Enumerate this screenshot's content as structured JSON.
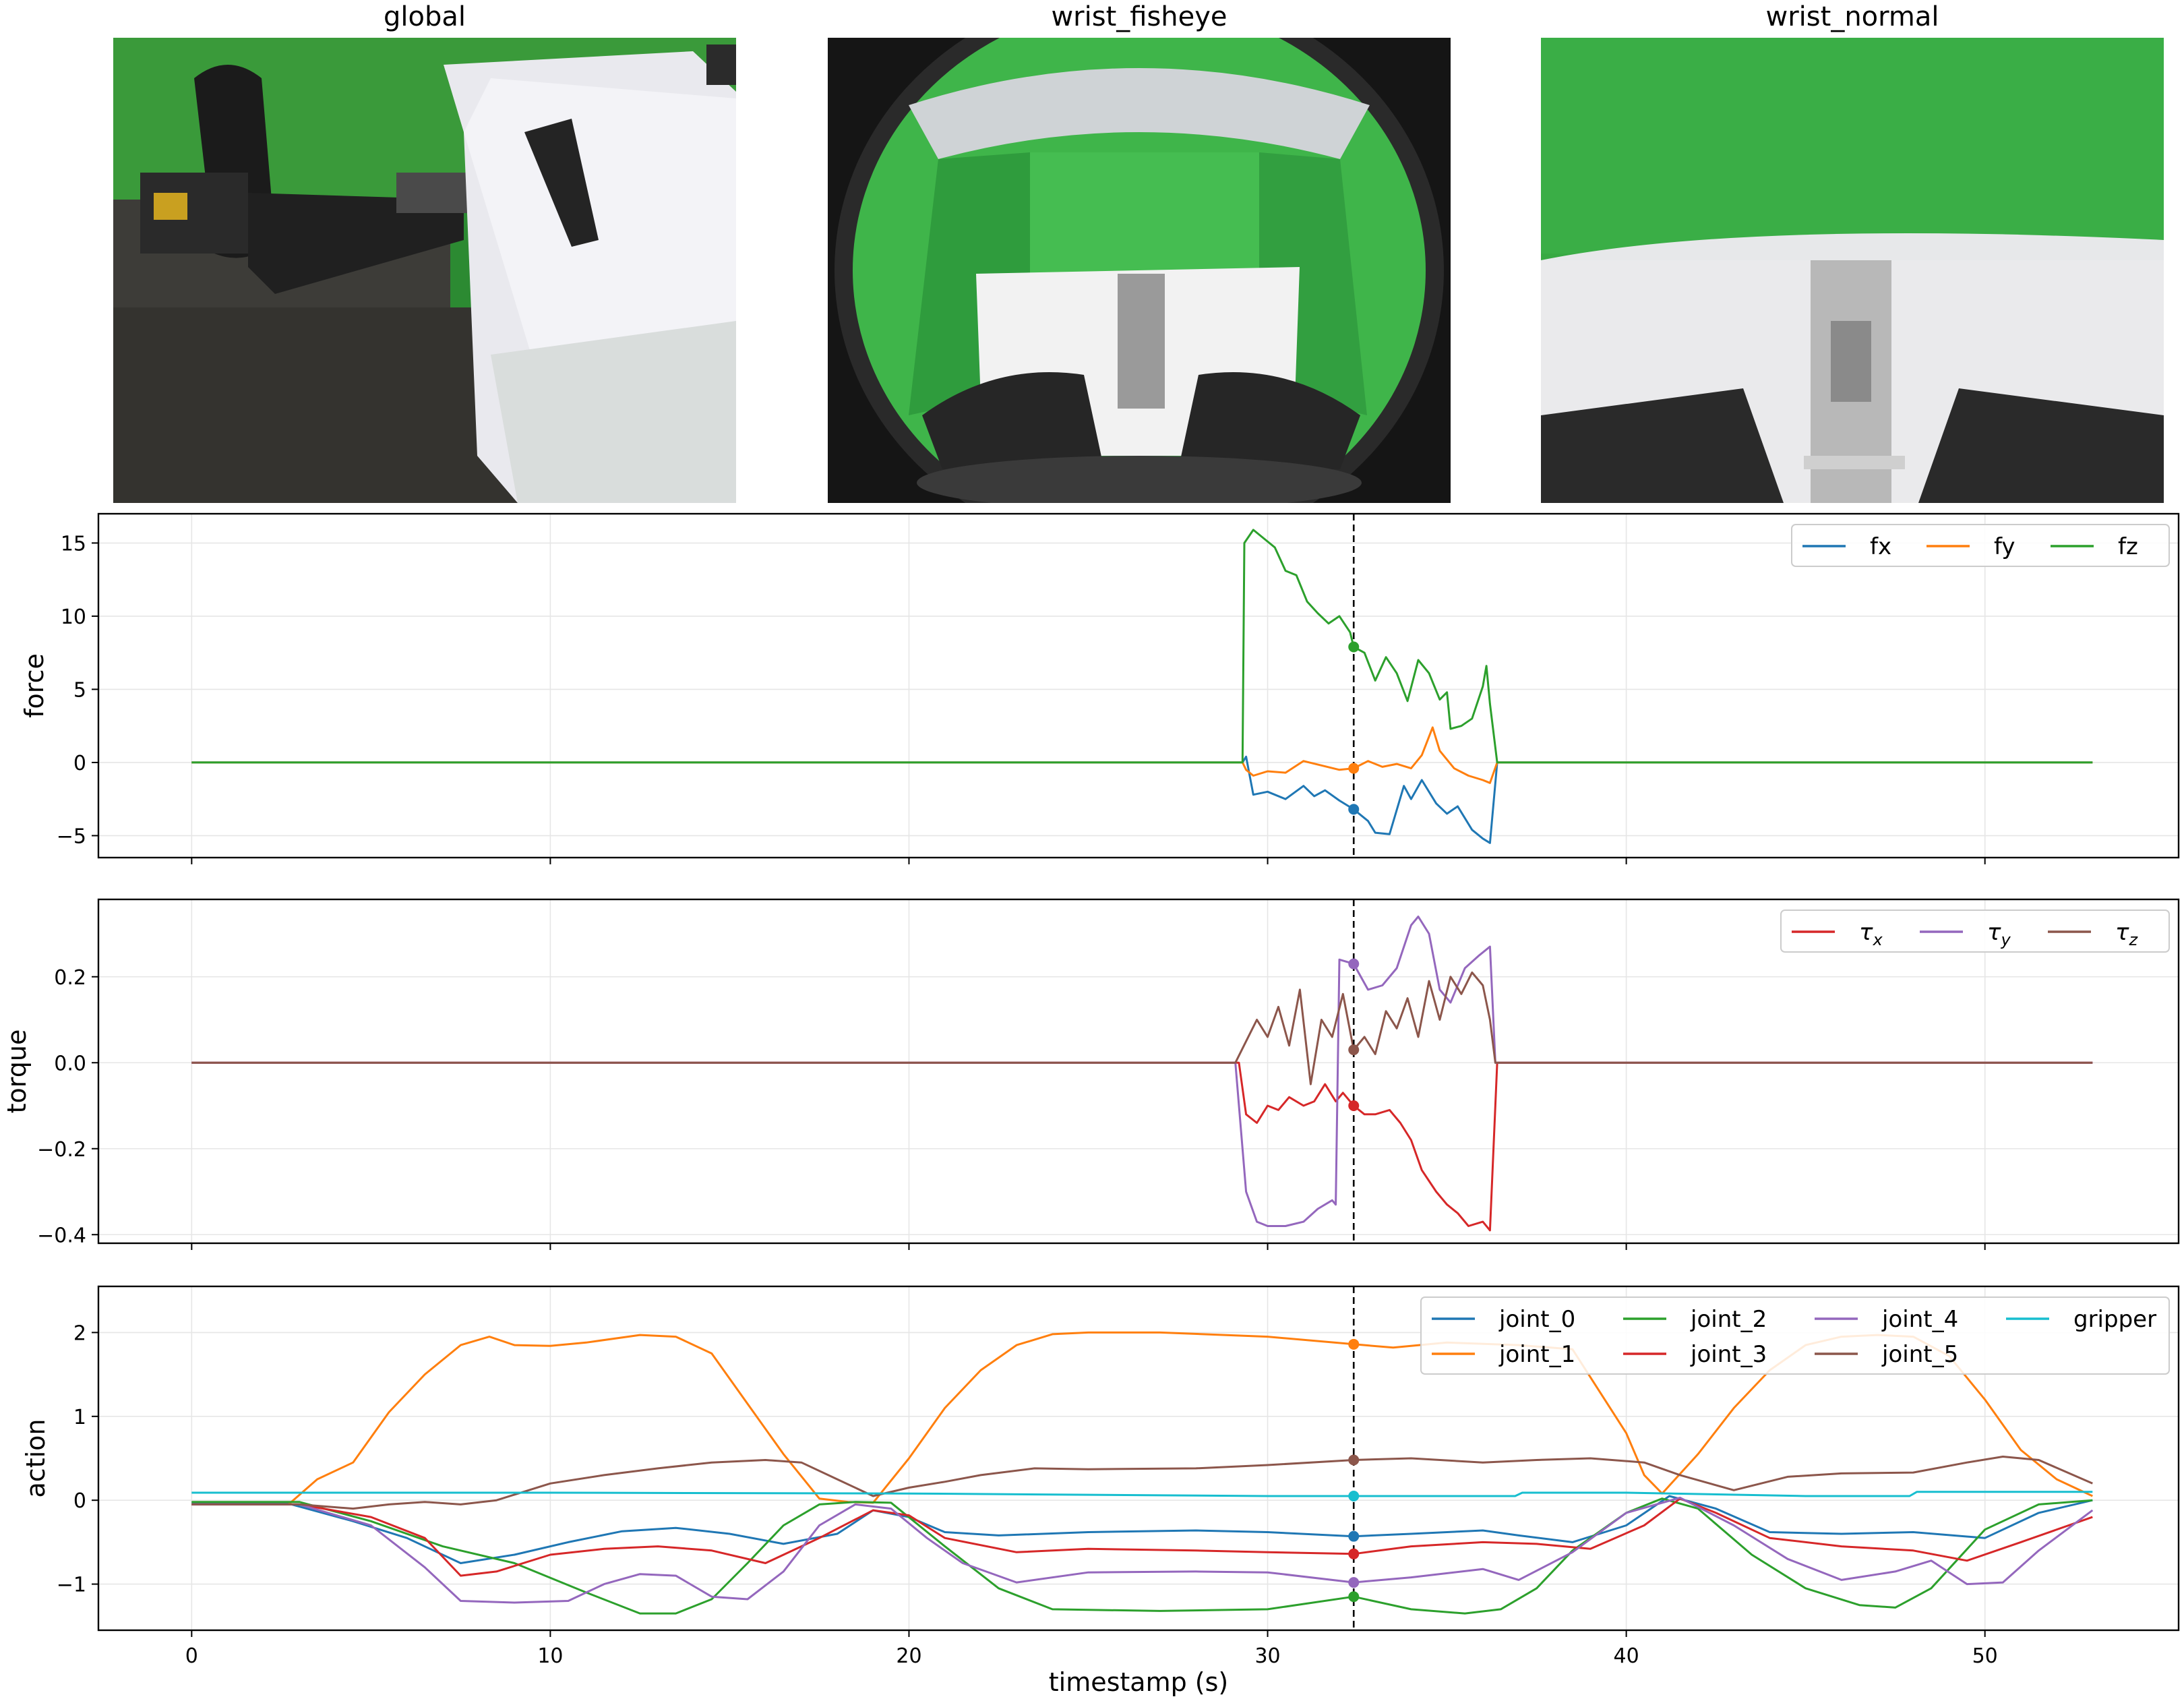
{
  "cameras": [
    {
      "title": "global",
      "icon": "room-scene-photo"
    },
    {
      "title": "wrist_fisheye",
      "icon": "fisheye-gripper-photo"
    },
    {
      "title": "wrist_normal",
      "icon": "gripper-closeup-photo"
    }
  ],
  "colors": {
    "fx": "#1f77b4",
    "fy": "#ff7f0e",
    "fz": "#2ca02c",
    "tx": "#d62728",
    "ty": "#9467bd",
    "tz": "#8c564b",
    "joint_0": "#1f77b4",
    "joint_1": "#ff7f0e",
    "joint_2": "#2ca02c",
    "joint_3": "#d62728",
    "joint_4": "#9467bd",
    "joint_5": "#8c564b",
    "gripper": "#17becf",
    "grid": "#e6e6e6",
    "cursor": "#000000"
  },
  "chart_data": [
    {
      "type": "line",
      "ylabel": "force",
      "xlim": [
        -2.6,
        55.4
      ],
      "ylim": [
        -6.5,
        17.0
      ],
      "xticks": [
        0,
        10,
        20,
        30,
        40,
        50
      ],
      "xtick_labels": [
        "0",
        "10",
        "20",
        "30",
        "40",
        "50"
      ],
      "yticks": [
        -5,
        0,
        5,
        10,
        15
      ],
      "ytick_labels": [
        "−5",
        "0",
        "5",
        "10",
        "15"
      ],
      "grid": true,
      "legend_position": "top-right",
      "legend_columns": 3,
      "cursor_x": 32.4,
      "series": [
        {
          "name": "fx",
          "color_key": "fx",
          "x": [
            0,
            29.3,
            29.4,
            29.6,
            30.0,
            30.5,
            31.0,
            31.3,
            31.6,
            32.0,
            32.4,
            32.8,
            33.0,
            33.4,
            33.8,
            34.0,
            34.3,
            34.7,
            35.0,
            35.3,
            35.7,
            36.0,
            36.2,
            36.4,
            53
          ],
          "y": [
            0,
            0,
            0.4,
            -2.2,
            -2.0,
            -2.5,
            -1.6,
            -2.3,
            -1.9,
            -2.6,
            -3.2,
            -4.0,
            -4.8,
            -4.9,
            -1.6,
            -2.5,
            -1.2,
            -2.8,
            -3.5,
            -3.0,
            -4.6,
            -5.2,
            -5.5,
            0,
            0
          ]
        },
        {
          "name": "fy",
          "color_key": "fy",
          "x": [
            0,
            29.3,
            29.4,
            29.6,
            30.0,
            30.5,
            31.0,
            31.5,
            32.0,
            32.4,
            32.8,
            33.2,
            33.6,
            34.0,
            34.3,
            34.6,
            34.8,
            35.2,
            35.6,
            36.0,
            36.2,
            36.4,
            53
          ],
          "y": [
            0,
            0,
            -0.5,
            -0.9,
            -0.6,
            -0.7,
            0.1,
            -0.2,
            -0.5,
            -0.4,
            0.1,
            -0.3,
            -0.1,
            -0.4,
            0.5,
            2.4,
            0.8,
            -0.4,
            -0.9,
            -1.2,
            -1.4,
            0,
            0
          ]
        },
        {
          "name": "fz",
          "color_key": "fz",
          "x": [
            0,
            29.3,
            29.35,
            29.6,
            29.9,
            30.2,
            30.5,
            30.8,
            31.1,
            31.4,
            31.7,
            32.0,
            32.3,
            32.4,
            32.7,
            33.0,
            33.3,
            33.6,
            33.9,
            34.2,
            34.5,
            34.8,
            35.0,
            35.1,
            35.4,
            35.7,
            36.0,
            36.1,
            36.2,
            36.4,
            53
          ],
          "y": [
            0,
            0,
            15.0,
            15.9,
            15.3,
            14.7,
            13.1,
            12.8,
            11.0,
            10.2,
            9.5,
            10.0,
            8.9,
            7.9,
            7.5,
            5.6,
            7.2,
            6.1,
            4.2,
            7.0,
            6.1,
            4.3,
            4.8,
            2.3,
            2.5,
            3.0,
            5.2,
            6.6,
            4.0,
            0,
            0
          ]
        }
      ]
    },
    {
      "type": "line",
      "ylabel": "torque",
      "xlim": [
        -2.6,
        55.4
      ],
      "ylim": [
        -0.42,
        0.38
      ],
      "xticks": [
        0,
        10,
        20,
        30,
        40,
        50
      ],
      "xtick_labels": [
        "0",
        "10",
        "20",
        "30",
        "40",
        "50"
      ],
      "yticks": [
        -0.4,
        -0.2,
        0.0,
        0.2
      ],
      "ytick_labels": [
        "−0.4",
        "−0.2",
        "0.0",
        "0.2"
      ],
      "grid": true,
      "legend_position": "top-right",
      "legend_columns": 3,
      "cursor_x": 32.4,
      "series": [
        {
          "name": "τx",
          "color_key": "tx",
          "x": [
            0,
            29.2,
            29.4,
            29.7,
            30.0,
            30.3,
            30.6,
            31.0,
            31.3,
            31.6,
            31.9,
            32.1,
            32.4,
            32.7,
            33.0,
            33.4,
            33.7,
            34.0,
            34.3,
            34.7,
            35.0,
            35.3,
            35.6,
            36.0,
            36.2,
            36.4,
            53
          ],
          "y": [
            0,
            0,
            -0.12,
            -0.14,
            -0.1,
            -0.11,
            -0.08,
            -0.1,
            -0.09,
            -0.05,
            -0.09,
            -0.07,
            -0.1,
            -0.12,
            -0.12,
            -0.11,
            -0.14,
            -0.18,
            -0.25,
            -0.3,
            -0.33,
            -0.35,
            -0.38,
            -0.37,
            -0.39,
            0,
            0
          ]
        },
        {
          "name": "τy",
          "color_key": "ty",
          "x": [
            0,
            29.1,
            29.4,
            29.7,
            30.0,
            30.5,
            31.0,
            31.4,
            31.8,
            31.9,
            32.0,
            32.4,
            32.8,
            33.2,
            33.6,
            34.0,
            34.2,
            34.5,
            34.8,
            35.1,
            35.5,
            35.9,
            36.2,
            36.35,
            53
          ],
          "y": [
            0,
            0,
            -0.3,
            -0.37,
            -0.38,
            -0.38,
            -0.37,
            -0.34,
            -0.32,
            -0.33,
            0.24,
            0.23,
            0.17,
            0.18,
            0.22,
            0.32,
            0.34,
            0.3,
            0.17,
            0.14,
            0.22,
            0.25,
            0.27,
            0,
            0
          ]
        },
        {
          "name": "τz",
          "color_key": "tz",
          "x": [
            0,
            29.1,
            29.4,
            29.7,
            30.0,
            30.3,
            30.6,
            30.9,
            31.2,
            31.5,
            31.8,
            32.1,
            32.4,
            32.7,
            33.0,
            33.3,
            33.6,
            33.9,
            34.2,
            34.5,
            34.8,
            35.1,
            35.4,
            35.7,
            36.0,
            36.2,
            36.35,
            53
          ],
          "y": [
            0,
            0,
            0.05,
            0.1,
            0.06,
            0.13,
            0.04,
            0.17,
            -0.05,
            0.1,
            0.06,
            0.16,
            0.03,
            0.06,
            0.02,
            0.12,
            0.08,
            0.15,
            0.06,
            0.19,
            0.1,
            0.2,
            0.16,
            0.21,
            0.18,
            0.1,
            0,
            0
          ]
        }
      ]
    },
    {
      "type": "line",
      "ylabel": "action",
      "xlabel": "timestamp (s)",
      "xlim": [
        -2.6,
        55.4
      ],
      "ylim": [
        -1.55,
        2.55
      ],
      "xticks": [
        0,
        10,
        20,
        30,
        40,
        50
      ],
      "xtick_labels": [
        "0",
        "10",
        "20",
        "30",
        "40",
        "50"
      ],
      "yticks": [
        -1,
        0,
        1,
        2
      ],
      "ytick_labels": [
        "−1",
        "0",
        "1",
        "2"
      ],
      "grid": true,
      "legend_position": "top-right",
      "legend_columns": 4,
      "cursor_x": 32.4,
      "series": [
        {
          "name": "joint_0",
          "color_key": "joint_0",
          "x": [
            0,
            2.7,
            4.5,
            6,
            7.5,
            9,
            10.5,
            12,
            13.5,
            15,
            16.5,
            18,
            19,
            20,
            21,
            22.5,
            25,
            28,
            30,
            32.4,
            34,
            36,
            37,
            38.5,
            40,
            41.2,
            42.5,
            44,
            46,
            48,
            50,
            51.5,
            53
          ],
          "y": [
            -0.03,
            -0.04,
            -0.25,
            -0.45,
            -0.75,
            -0.65,
            -0.5,
            -0.37,
            -0.33,
            -0.4,
            -0.52,
            -0.4,
            -0.12,
            -0.2,
            -0.38,
            -0.42,
            -0.38,
            -0.36,
            -0.38,
            -0.43,
            -0.4,
            -0.36,
            -0.42,
            -0.5,
            -0.3,
            0.05,
            -0.1,
            -0.38,
            -0.4,
            -0.38,
            -0.45,
            -0.15,
            0.0
          ]
        },
        {
          "name": "joint_1",
          "color_key": "joint_1",
          "x": [
            0,
            2.7,
            3.5,
            4.5,
            5.5,
            6.5,
            7.5,
            8.3,
            9,
            10,
            11,
            12.5,
            13.5,
            14.5,
            15.5,
            16.5,
            17.5,
            18.3,
            19,
            20,
            21,
            22,
            23,
            24,
            25,
            27,
            30,
            32.4,
            33.5,
            35,
            37,
            38.5,
            40,
            40.5,
            41,
            42,
            43,
            44,
            45,
            46,
            47,
            48,
            49,
            50,
            51,
            52,
            53
          ],
          "y": [
            -0.05,
            -0.05,
            0.25,
            0.45,
            1.05,
            1.5,
            1.85,
            1.95,
            1.85,
            1.84,
            1.88,
            1.97,
            1.95,
            1.75,
            1.15,
            0.55,
            0.02,
            -0.02,
            -0.03,
            0.5,
            1.1,
            1.55,
            1.85,
            1.98,
            2.0,
            2.0,
            1.95,
            1.86,
            1.82,
            1.88,
            1.85,
            1.8,
            0.8,
            0.3,
            0.08,
            0.55,
            1.1,
            1.55,
            1.85,
            1.95,
            1.97,
            1.95,
            1.72,
            1.2,
            0.6,
            0.25,
            0.05
          ]
        },
        {
          "name": "joint_2",
          "color_key": "joint_2",
          "x": [
            0,
            3,
            5,
            7,
            9,
            11,
            12.5,
            13.5,
            14.5,
            15.5,
            16.5,
            17.5,
            18.5,
            19.5,
            21,
            22.5,
            24,
            27,
            30,
            32.4,
            34,
            35.5,
            36.5,
            37.5,
            38.5,
            40,
            41,
            42,
            43.5,
            45,
            46.5,
            47.5,
            48.5,
            50,
            51.5,
            53
          ],
          "y": [
            -0.02,
            -0.02,
            -0.25,
            -0.55,
            -0.75,
            -1.1,
            -1.35,
            -1.35,
            -1.18,
            -0.75,
            -0.3,
            -0.05,
            -0.02,
            -0.03,
            -0.55,
            -1.05,
            -1.3,
            -1.32,
            -1.3,
            -1.15,
            -1.3,
            -1.35,
            -1.3,
            -1.05,
            -0.6,
            -0.15,
            0.02,
            -0.1,
            -0.65,
            -1.05,
            -1.25,
            -1.28,
            -1.05,
            -0.35,
            -0.05,
            0.0
          ]
        },
        {
          "name": "joint_3",
          "color_key": "joint_3",
          "x": [
            0,
            3,
            5,
            6.5,
            7.5,
            8.5,
            10,
            11.5,
            13,
            14.5,
            16,
            17.5,
            19,
            20,
            21,
            23,
            25,
            28,
            30,
            32.4,
            34,
            36,
            37.5,
            39,
            40.5,
            41.5,
            42.5,
            44,
            46,
            48,
            49.5,
            51,
            53
          ],
          "y": [
            -0.05,
            -0.05,
            -0.2,
            -0.45,
            -0.9,
            -0.85,
            -0.65,
            -0.58,
            -0.55,
            -0.6,
            -0.75,
            -0.45,
            -0.12,
            -0.18,
            -0.45,
            -0.62,
            -0.58,
            -0.6,
            -0.62,
            -0.64,
            -0.55,
            -0.5,
            -0.52,
            -0.58,
            -0.3,
            0.02,
            -0.15,
            -0.45,
            -0.55,
            -0.6,
            -0.72,
            -0.5,
            -0.2
          ]
        },
        {
          "name": "joint_4",
          "color_key": "joint_4",
          "x": [
            0,
            3,
            5,
            6.5,
            7.5,
            9,
            10.5,
            11.5,
            12.5,
            13.5,
            14.5,
            15.5,
            16.5,
            17.5,
            18.5,
            19.5,
            20.5,
            21.5,
            23,
            25,
            28,
            30,
            32.4,
            34,
            36,
            37,
            38.5,
            40,
            41.5,
            43,
            44.5,
            46,
            47.5,
            48.5,
            49.5,
            50.5,
            51.5,
            53
          ],
          "y": [
            -0.05,
            -0.05,
            -0.3,
            -0.8,
            -1.2,
            -1.22,
            -1.2,
            -1.0,
            -0.88,
            -0.9,
            -1.15,
            -1.18,
            -0.85,
            -0.3,
            -0.05,
            -0.1,
            -0.45,
            -0.75,
            -0.98,
            -0.86,
            -0.85,
            -0.86,
            -0.98,
            -0.92,
            -0.82,
            -0.95,
            -0.62,
            -0.15,
            0.03,
            -0.3,
            -0.7,
            -0.95,
            -0.85,
            -0.72,
            -1.0,
            -0.98,
            -0.6,
            -0.12
          ]
        },
        {
          "name": "joint_5",
          "color_key": "joint_5",
          "x": [
            0,
            3,
            4.5,
            5.5,
            6.5,
            7.5,
            8.5,
            10,
            11.5,
            13,
            14.5,
            16,
            17,
            18,
            19,
            20,
            21,
            22,
            23.5,
            25,
            28,
            30,
            32.4,
            34,
            36,
            37.5,
            39,
            40.5,
            41.5,
            43,
            44.5,
            46,
            48,
            49.5,
            50.5,
            51.5,
            53
          ],
          "y": [
            -0.05,
            -0.05,
            -0.1,
            -0.05,
            -0.02,
            -0.05,
            0.0,
            0.2,
            0.3,
            0.38,
            0.45,
            0.48,
            0.45,
            0.25,
            0.05,
            0.15,
            0.22,
            0.3,
            0.38,
            0.37,
            0.38,
            0.42,
            0.48,
            0.5,
            0.45,
            0.48,
            0.5,
            0.45,
            0.3,
            0.12,
            0.28,
            0.32,
            0.33,
            0.45,
            0.52,
            0.48,
            0.2
          ]
        },
        {
          "name": "gripper",
          "color_key": "gripper",
          "x": [
            0,
            10,
            20,
            30,
            32.4,
            35,
            36.9,
            37.1,
            40,
            45,
            47.9,
            48.1,
            53
          ],
          "y": [
            0.09,
            0.09,
            0.08,
            0.05,
            0.05,
            0.05,
            0.05,
            0.09,
            0.09,
            0.05,
            0.05,
            0.1,
            0.1
          ]
        }
      ]
    }
  ]
}
